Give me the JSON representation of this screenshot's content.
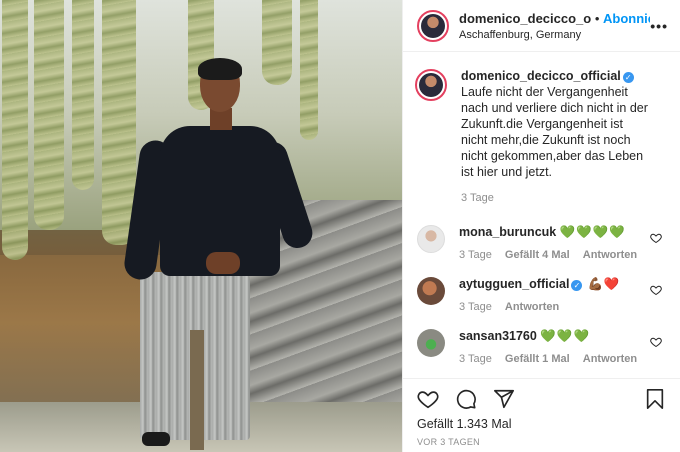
{
  "header": {
    "username": "domenico_decicco_o",
    "separator": "•",
    "follow_label": "Abonnieren",
    "location": "Aschaffenburg, Germany",
    "more_icon": "more-horizontal-icon"
  },
  "caption": {
    "author": "domenico_decicco_official",
    "verified": true,
    "text": "Laufe nicht der Vergangenheit nach und verliere dich nicht in der Zukunft.die Vergangenheit ist nicht mehr,die Zukunft ist noch nicht gekommen,aber das Leben ist hier und jetzt.",
    "age": "3 Tage"
  },
  "comments": [
    {
      "author": "mona_buruncuk",
      "verified": false,
      "text": "💚💚💚💚",
      "age": "3 Tage",
      "likes": "Gefällt 4 Mal",
      "reply": "Antworten"
    },
    {
      "author": "aytugguen_official",
      "verified": true,
      "text": "💪🏾❤️",
      "age": "3 Tage",
      "likes": "",
      "reply": "Antworten"
    },
    {
      "author": "sansan31760",
      "verified": false,
      "text": "💚💚💚",
      "age": "3 Tage",
      "likes": "Gefällt 1 Mal",
      "reply": "Antworten"
    }
  ],
  "actions": {
    "icons": [
      "heart-icon",
      "comment-icon",
      "share-icon",
      "bookmark-icon"
    ],
    "likes_text": "Gefällt 1.343 Mal",
    "date": "VOR 3 TAGEN"
  },
  "colors": {
    "link_blue": "#0095f6",
    "verified_blue": "#3897f0",
    "muted": "#8e8e8e",
    "text": "#262626"
  }
}
